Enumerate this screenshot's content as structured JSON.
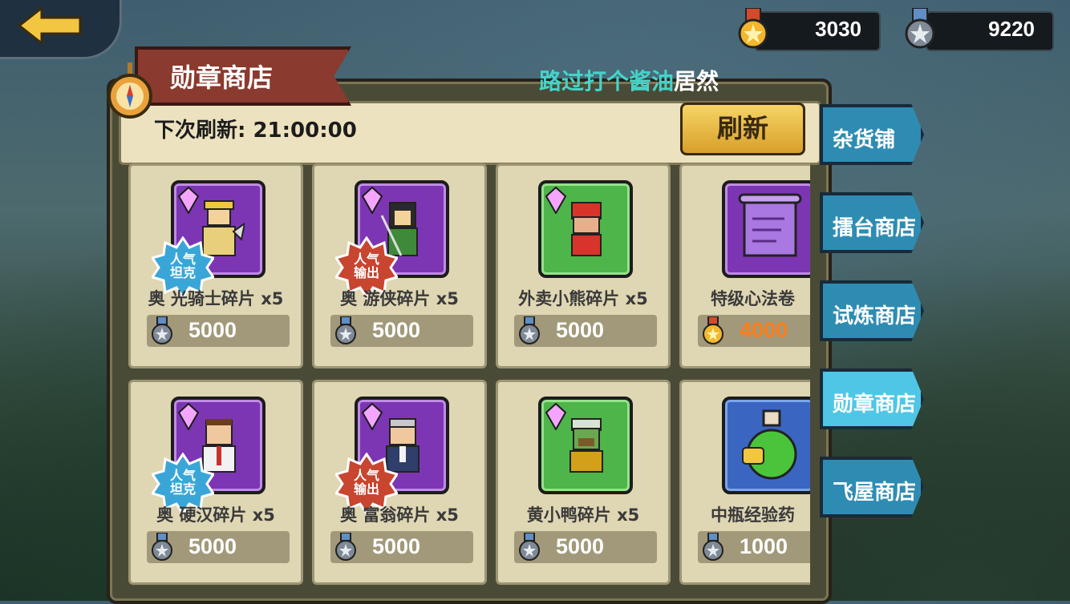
{
  "header": {
    "back_label": "",
    "currencies": [
      {
        "icon": "gold-medal-icon",
        "value": "3030"
      },
      {
        "icon": "silver-medal-icon",
        "value": "9220"
      }
    ]
  },
  "shop": {
    "title": "勋章商店",
    "marquee_highlight": "路过打个酱油",
    "marquee_rest": "居然",
    "refresh_countdown": "下次刷新: 21:00:00",
    "refresh_button": "刷新"
  },
  "items": [
    {
      "name": "奥  光骑士碎片 x5",
      "price": "5000",
      "currency": "silver",
      "frame": "purple",
      "badge": "人气坦克",
      "badge_color": "blue"
    },
    {
      "name": "奥  游侠碎片 x5",
      "price": "5000",
      "currency": "silver",
      "frame": "purple",
      "badge": "人气输出",
      "badge_color": "red"
    },
    {
      "name": "外卖小熊碎片 x5",
      "price": "5000",
      "currency": "silver",
      "frame": "green",
      "badge": "",
      "badge_color": ""
    },
    {
      "name": "特级心法卷",
      "price": "4000",
      "currency": "gold",
      "frame": "purple",
      "badge": "",
      "badge_color": ""
    },
    {
      "name": "奥  硬汉碎片 x5",
      "price": "5000",
      "currency": "silver",
      "frame": "purple",
      "badge": "人气坦克",
      "badge_color": "blue"
    },
    {
      "name": "奥  富翁碎片 x5",
      "price": "5000",
      "currency": "silver",
      "frame": "purple",
      "badge": "人气输出",
      "badge_color": "red"
    },
    {
      "name": "黄小鸭碎片 x5",
      "price": "5000",
      "currency": "silver",
      "frame": "green",
      "badge": "",
      "badge_color": ""
    },
    {
      "name": "中瓶经验药",
      "price": "1000",
      "currency": "silver",
      "frame": "blue",
      "badge": "",
      "badge_color": ""
    }
  ],
  "tabs": [
    {
      "label": "杂货铺",
      "active": false
    },
    {
      "label": "擂台商店",
      "active": false
    },
    {
      "label": "试炼商店",
      "active": false
    },
    {
      "label": "勋章商店",
      "active": true
    },
    {
      "label": "飞屋商店",
      "active": false
    }
  ],
  "colors": {
    "accent_cyan": "#45d4c8",
    "price_gold": "#ff7d1a",
    "tab_active": "#4fc6e6"
  }
}
